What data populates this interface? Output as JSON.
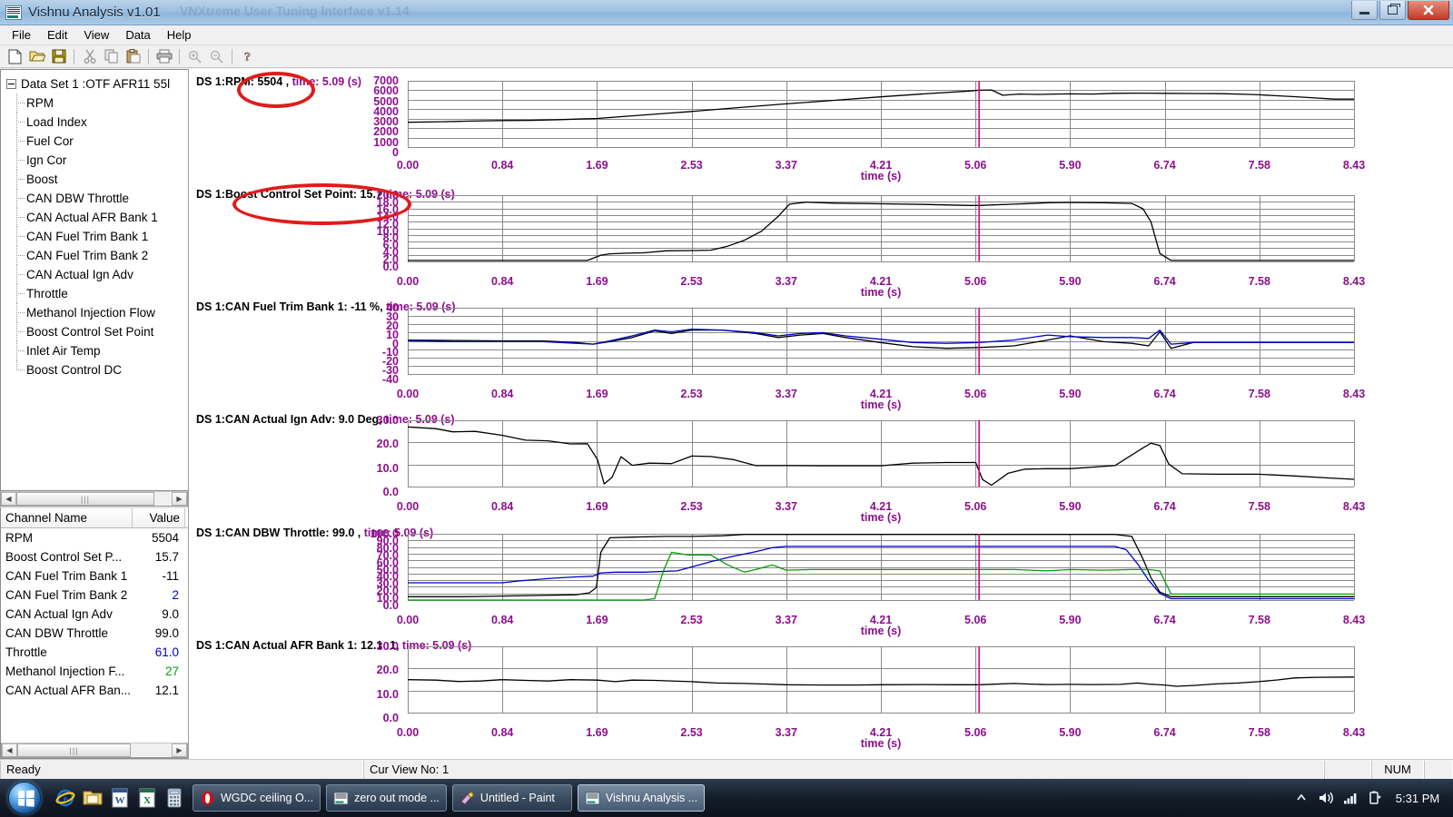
{
  "window": {
    "title": "Vishnu Analysis v1.01",
    "ghost_title": "VNXtreme User Tuning Interface v1.14",
    "icon": "app-icon",
    "minimize": "–",
    "maximize": "❐",
    "close": "✕"
  },
  "menu": [
    "File",
    "Edit",
    "View",
    "Data",
    "Help"
  ],
  "toolbar": {
    "buttons": [
      "new-icon",
      "open-icon",
      "save-icon",
      "cut-icon",
      "copy-icon",
      "paste-icon",
      "print-icon",
      "zoom-in-icon",
      "zoom-out-icon",
      "help-icon"
    ]
  },
  "tree": {
    "root": "Data Set 1 :OTF  AFR11  55l",
    "items": [
      "RPM",
      "Load Index",
      "Fuel Cor",
      "Ign Cor",
      "Boost",
      "CAN DBW Throttle",
      "CAN Actual AFR Bank 1",
      "CAN Fuel Trim Bank 1",
      "CAN Fuel Trim Bank 2",
      "CAN Actual Ign Adv",
      "Throttle",
      "Methanol Injection Flow",
      "Boost Control Set Point",
      "Inlet Air Temp",
      "Boost Control DC"
    ]
  },
  "grid": {
    "headers": [
      "Channel Name",
      "Value"
    ],
    "rows": [
      {
        "name": "RPM",
        "value": "5504",
        "color": "#000000"
      },
      {
        "name": "Boost Control Set P...",
        "value": "15.7",
        "color": "#000000"
      },
      {
        "name": "CAN Fuel Trim Bank 1",
        "value": "-11",
        "color": "#000000"
      },
      {
        "name": "CAN Fuel Trim Bank 2",
        "value": "2",
        "color": "#0000cc"
      },
      {
        "name": "CAN Actual Ign Adv",
        "value": "9.0",
        "color": "#000000"
      },
      {
        "name": "CAN DBW Throttle",
        "value": "99.0",
        "color": "#000000"
      },
      {
        "name": "Throttle",
        "value": "61.0",
        "color": "#0000cc"
      },
      {
        "name": "Methanol Injection F...",
        "value": "27",
        "color": "#00a000"
      },
      {
        "name": "CAN Actual AFR Ban...",
        "value": "12.1",
        "color": "#000000"
      }
    ]
  },
  "annotations": [
    {
      "name": "rpm-highlight",
      "label": "RPM: 5504"
    },
    {
      "name": "boost-setpoint-highlight",
      "label": "DS 1:Boost Control Set Point: 15.7"
    }
  ],
  "statusbar": {
    "ready": "Ready",
    "view": "Cur View No: 1",
    "num": "NUM"
  },
  "taskbar": {
    "start": "start-orb",
    "quicklaunch": [
      "internet-explorer-icon",
      "folder-icon",
      "word-icon",
      "excel-icon",
      "calculator-icon"
    ],
    "tasks": [
      {
        "label": "WGDC ceiling O...",
        "icon": "opera-icon",
        "active": false
      },
      {
        "label": "zero out mode ...",
        "icon": "vishnu-icon",
        "active": false
      },
      {
        "label": "Untitled - Paint",
        "icon": "paint-icon",
        "active": false
      },
      {
        "label": "Vishnu Analysis ...",
        "icon": "vishnu-icon",
        "active": true
      }
    ],
    "tray": [
      "show-hidden-icons-icon",
      "volume-icon",
      "network-icon",
      "battery-icon"
    ],
    "clock": "5:31 PM"
  },
  "chart_data": {
    "shared": {
      "xlabel": "time (s)",
      "xticks": [
        "0.00",
        "0.84",
        "1.69",
        "2.53",
        "3.37",
        "4.21",
        "5.06",
        "5.90",
        "6.74",
        "7.58",
        "8.43"
      ],
      "xlim": [
        0,
        8.43
      ],
      "cursor_time": "5.09",
      "cursor_color": "#e0007f",
      "grid": true,
      "legend": "none"
    },
    "panels": [
      {
        "type": "line",
        "name": "rpm-panel",
        "title": "DS 1:RPM: 5504  ,",
        "title_time": "time: 5.09 (s)",
        "ylabel": "",
        "yticks": [
          "7000",
          "6000",
          "5000",
          "4000",
          "3000",
          "2000",
          "1000",
          "0"
        ],
        "ylim": [
          0,
          7000
        ],
        "series": [
          {
            "name": "RPM",
            "color": "#000000",
            "x": [
              0.0,
              0.3,
              0.55,
              0.84,
              1.1,
              1.35,
              1.69,
              2.0,
              2.3,
              2.53,
              2.9,
              3.37,
              3.8,
              4.21,
              4.6,
              5.0,
              5.09,
              5.2,
              5.3,
              5.45,
              5.6,
              5.9,
              6.1,
              6.3,
              6.5,
              6.74,
              7.0,
              7.25,
              7.5,
              7.58,
              7.9,
              8.1,
              8.25,
              8.43
            ],
            "y": [
              2620,
              2680,
              2740,
              2800,
              2820,
              2900,
              3020,
              3300,
              3560,
              3760,
              4120,
              4560,
              4940,
              5300,
              5620,
              5920,
              6000,
              6030,
              5480,
              5600,
              5560,
              5620,
              5600,
              5680,
              5700,
              5680,
              5660,
              5640,
              5560,
              5520,
              5320,
              5180,
              5060,
              5060
            ]
          }
        ]
      },
      {
        "type": "line",
        "name": "boost-control-setpoint-panel",
        "title": "DS 1:Boost Control Set Point: 15.7",
        "title_time": "time: 5.09 (s)",
        "ylabel": "",
        "yticks": [
          "20.0",
          "18.0",
          "16.0",
          "14.0",
          "12.0",
          "10.0",
          "8.0",
          "6.0",
          "4.0",
          "2.0",
          "0.0"
        ],
        "ylim": [
          0,
          20
        ],
        "series": [
          {
            "name": "Boost Control Set Point",
            "color": "#000000",
            "x": [
              0.0,
              0.84,
              1.6,
              1.72,
              1.8,
              1.95,
              2.1,
              2.3,
              2.53,
              2.7,
              2.85,
              3.0,
              3.15,
              3.3,
              3.4,
              3.55,
              3.8,
              4.21,
              4.6,
              5.0,
              5.09,
              5.4,
              5.7,
              5.9,
              6.2,
              6.45,
              6.55,
              6.62,
              6.7,
              6.8,
              7.58,
              8.43
            ],
            "y": [
              0.3,
              0.3,
              0.3,
              1.9,
              2.3,
              2.5,
              2.6,
              3.2,
              3.3,
              3.4,
              4.6,
              6.4,
              9.1,
              13.6,
              17.3,
              17.9,
              17.6,
              17.4,
              17.2,
              16.9,
              16.9,
              17.3,
              17.7,
              17.8,
              17.7,
              17.5,
              15.9,
              12.0,
              2.4,
              0.3,
              0.3,
              0.3
            ]
          }
        ]
      },
      {
        "type": "line",
        "name": "can-fuel-trim-bank-1-panel",
        "title": "DS 1:CAN Fuel Trim Bank 1: -11  %,",
        "title_time": "time: 5.09 (s)",
        "ylabel": "%",
        "yticks": [
          "40",
          "30",
          "20",
          "10",
          "0",
          "-10",
          "-20",
          "-30",
          "-40"
        ],
        "ylim": [
          -40,
          40
        ],
        "series": [
          {
            "name": "CAN Fuel Trim Bank 1",
            "color": "#000000",
            "x": [
              0.0,
              0.4,
              0.84,
              1.2,
              1.5,
              1.65,
              1.8,
              2.0,
              2.2,
              2.35,
              2.53,
              2.8,
              3.1,
              3.3,
              3.5,
              3.7,
              3.9,
              4.21,
              4.5,
              4.8,
              5.09,
              5.4,
              5.7,
              5.9,
              6.2,
              6.45,
              6.6,
              6.7,
              6.8,
              7.0,
              8.43
            ],
            "y": [
              1,
              0.5,
              0,
              0,
              -2,
              -4,
              -1,
              4,
              12,
              9,
              13,
              13,
              9,
              4,
              7,
              9,
              4,
              -2,
              -7,
              -9,
              -8,
              -6,
              1,
              6,
              -1,
              -3,
              -6,
              11,
              -9,
              -2,
              -2
            ]
          },
          {
            "name": "CAN Fuel Trim Bank 2",
            "color": "#0000cc",
            "x": [
              0.0,
              0.4,
              0.84,
              1.2,
              1.5,
              1.65,
              1.8,
              2.0,
              2.2,
              2.35,
              2.53,
              2.8,
              3.1,
              3.3,
              3.5,
              3.7,
              3.9,
              4.21,
              4.5,
              4.8,
              5.09,
              5.4,
              5.7,
              5.9,
              6.2,
              6.45,
              6.6,
              6.7,
              6.8,
              7.0,
              8.43
            ],
            "y": [
              0,
              -1,
              -1,
              -1,
              -3,
              -4,
              0,
              6,
              13,
              11,
              14,
              13,
              10,
              6,
              9,
              10,
              6,
              2,
              -2,
              -3,
              -2,
              1,
              7,
              5,
              4,
              4,
              3,
              13,
              -4,
              -2,
              -2
            ]
          }
        ]
      },
      {
        "type": "line",
        "name": "can-actual-ign-adv-panel",
        "title": "DS 1:CAN Actual Ign Adv: 9.0  Deg,",
        "title_time": "time: 5.09 (s)",
        "ylabel": "Deg",
        "yticks": [
          "30.0",
          "20.0",
          "10.0",
          "0.0"
        ],
        "ylim": [
          0,
          30
        ],
        "series": [
          {
            "name": "CAN Actual Ign Adv",
            "color": "#000000",
            "x": [
              0.0,
              0.25,
              0.4,
              0.6,
              0.84,
              1.05,
              1.25,
              1.45,
              1.6,
              1.69,
              1.75,
              1.82,
              1.9,
              2.0,
              2.15,
              2.35,
              2.53,
              2.7,
              2.9,
              3.1,
              3.37,
              3.7,
              4.0,
              4.21,
              4.5,
              4.8,
              5.0,
              5.06,
              5.12,
              5.2,
              5.35,
              5.5,
              5.7,
              5.9,
              6.3,
              6.55,
              6.62,
              6.7,
              6.78,
              6.9,
              7.2,
              7.58,
              7.9,
              8.2,
              8.43
            ],
            "y": [
              27.0,
              26.2,
              24.8,
              25.0,
              23.2,
              21.0,
              20.7,
              19.3,
              19.4,
              12.3,
              1.2,
              4.2,
              13.5,
              9.6,
              10.6,
              10.4,
              13.8,
              13.6,
              12.2,
              9.5,
              9.5,
              9.4,
              9.4,
              9.4,
              10.6,
              10.9,
              10.9,
              10.9,
              3.2,
              0.6,
              6.1,
              7.9,
              8.1,
              8.1,
              9.5,
              17.5,
              19.6,
              18.6,
              10.2,
              5.8,
              5.6,
              5.6,
              4.8,
              3.9,
              3.3
            ]
          }
        ]
      },
      {
        "type": "line",
        "name": "can-dbw-throttle-panel",
        "title": "DS 1:CAN DBW Throttle: 99.0  ,",
        "title_time": "time: 5.09 (s)",
        "ylabel": "",
        "yticks": [
          "100.0",
          "90.0",
          "80.0",
          "70.0",
          "60.0",
          "50.0",
          "40.0",
          "30.0",
          "20.0",
          "10.0",
          "0.0"
        ],
        "ylim": [
          0,
          100
        ],
        "series": [
          {
            "name": "CAN DBW Throttle",
            "color": "#000000",
            "x": [
              0.0,
              0.5,
              0.84,
              1.2,
              1.5,
              1.62,
              1.68,
              1.72,
              1.8,
              2.0,
              2.3,
              2.53,
              2.8,
              3.0,
              3.37,
              4.21,
              5.09,
              5.9,
              6.3,
              6.45,
              6.55,
              6.62,
              6.7,
              6.8,
              7.0,
              7.58,
              8.43
            ],
            "y": [
              5,
              5,
              6,
              7,
              8,
              11,
              19,
              72,
              94,
              95,
              96,
              96,
              97,
              99,
              99,
              99,
              99,
              99,
              99,
              96,
              62,
              34,
              12,
              5,
              5,
              5,
              5
            ]
          },
          {
            "name": "Throttle",
            "color": "#0000cc",
            "x": [
              0.0,
              0.5,
              0.84,
              1.0,
              1.15,
              1.3,
              1.5,
              1.65,
              1.72,
              1.85,
              2.1,
              2.4,
              2.53,
              2.7,
              2.9,
              3.1,
              3.25,
              3.37,
              4.21,
              5.09,
              5.9,
              6.3,
              6.4,
              6.5,
              6.6,
              6.7,
              6.8,
              7.58,
              8.43
            ],
            "y": [
              26,
              26,
              26,
              29,
              31,
              33,
              35,
              36,
              41,
              42,
              42,
              44,
              50,
              58,
              66,
              73,
              79,
              81,
              81,
              81,
              81,
              81,
              76,
              55,
              30,
              10,
              2,
              2,
              2
            ]
          },
          {
            "name": "Methanol Injection Flow",
            "color": "#00a000",
            "x": [
              0.0,
              2.1,
              2.2,
              2.28,
              2.35,
              2.5,
              2.7,
              2.85,
              3.0,
              3.1,
              3.25,
              3.37,
              3.6,
              3.9,
              4.21,
              4.6,
              5.0,
              5.09,
              5.4,
              5.7,
              5.9,
              6.2,
              6.45,
              6.6,
              6.7,
              6.8,
              7.0,
              8.43
            ],
            "y": [
              0,
              0,
              2,
              45,
              72,
              68,
              68,
              53,
              42,
              46,
              53,
              45,
              46,
              46,
              46,
              46,
              46,
              46,
              46,
              44,
              46,
              45,
              46,
              46,
              44,
              9,
              9,
              9
            ]
          }
        ]
      },
      {
        "type": "line",
        "name": "can-actual-afr-bank-1-panel",
        "title": "DS 1:CAN Actual AFR Bank 1: 12.1  :1,",
        "title_time": "time: 5.09 (s)",
        "ylabel": ":1",
        "yticks": [
          "30.0",
          "20.0",
          "10.0",
          "0.0"
        ],
        "ylim": [
          0,
          30
        ],
        "series": [
          {
            "name": "CAN Actual AFR Bank 1",
            "color": "#000000",
            "x": [
              0.0,
              0.25,
              0.45,
              0.65,
              0.84,
              1.05,
              1.25,
              1.45,
              1.69,
              1.85,
              2.0,
              2.2,
              2.4,
              2.53,
              2.75,
              3.0,
              3.2,
              3.37,
              3.7,
              4.0,
              4.21,
              4.6,
              4.9,
              5.09,
              5.4,
              5.55,
              5.7,
              5.9,
              6.1,
              6.35,
              6.5,
              6.6,
              6.74,
              6.85,
              7.0,
              7.2,
              7.4,
              7.58,
              7.75,
              7.9,
              8.1,
              8.43
            ],
            "y": [
              14.9,
              14.7,
              14.1,
              14.3,
              14.9,
              14.6,
              14.3,
              14.9,
              14.7,
              14.0,
              14.7,
              14.6,
              14.2,
              14.0,
              13.4,
              13.2,
              12.9,
              12.6,
              12.5,
              12.5,
              12.6,
              12.7,
              12.6,
              12.6,
              13.2,
              12.9,
              12.7,
              12.8,
              12.7,
              12.8,
              13.4,
              12.9,
              12.5,
              11.9,
              12.3,
              13.0,
              13.4,
              14.0,
              14.8,
              15.7,
              16.0,
              16.1
            ]
          }
        ]
      }
    ]
  }
}
